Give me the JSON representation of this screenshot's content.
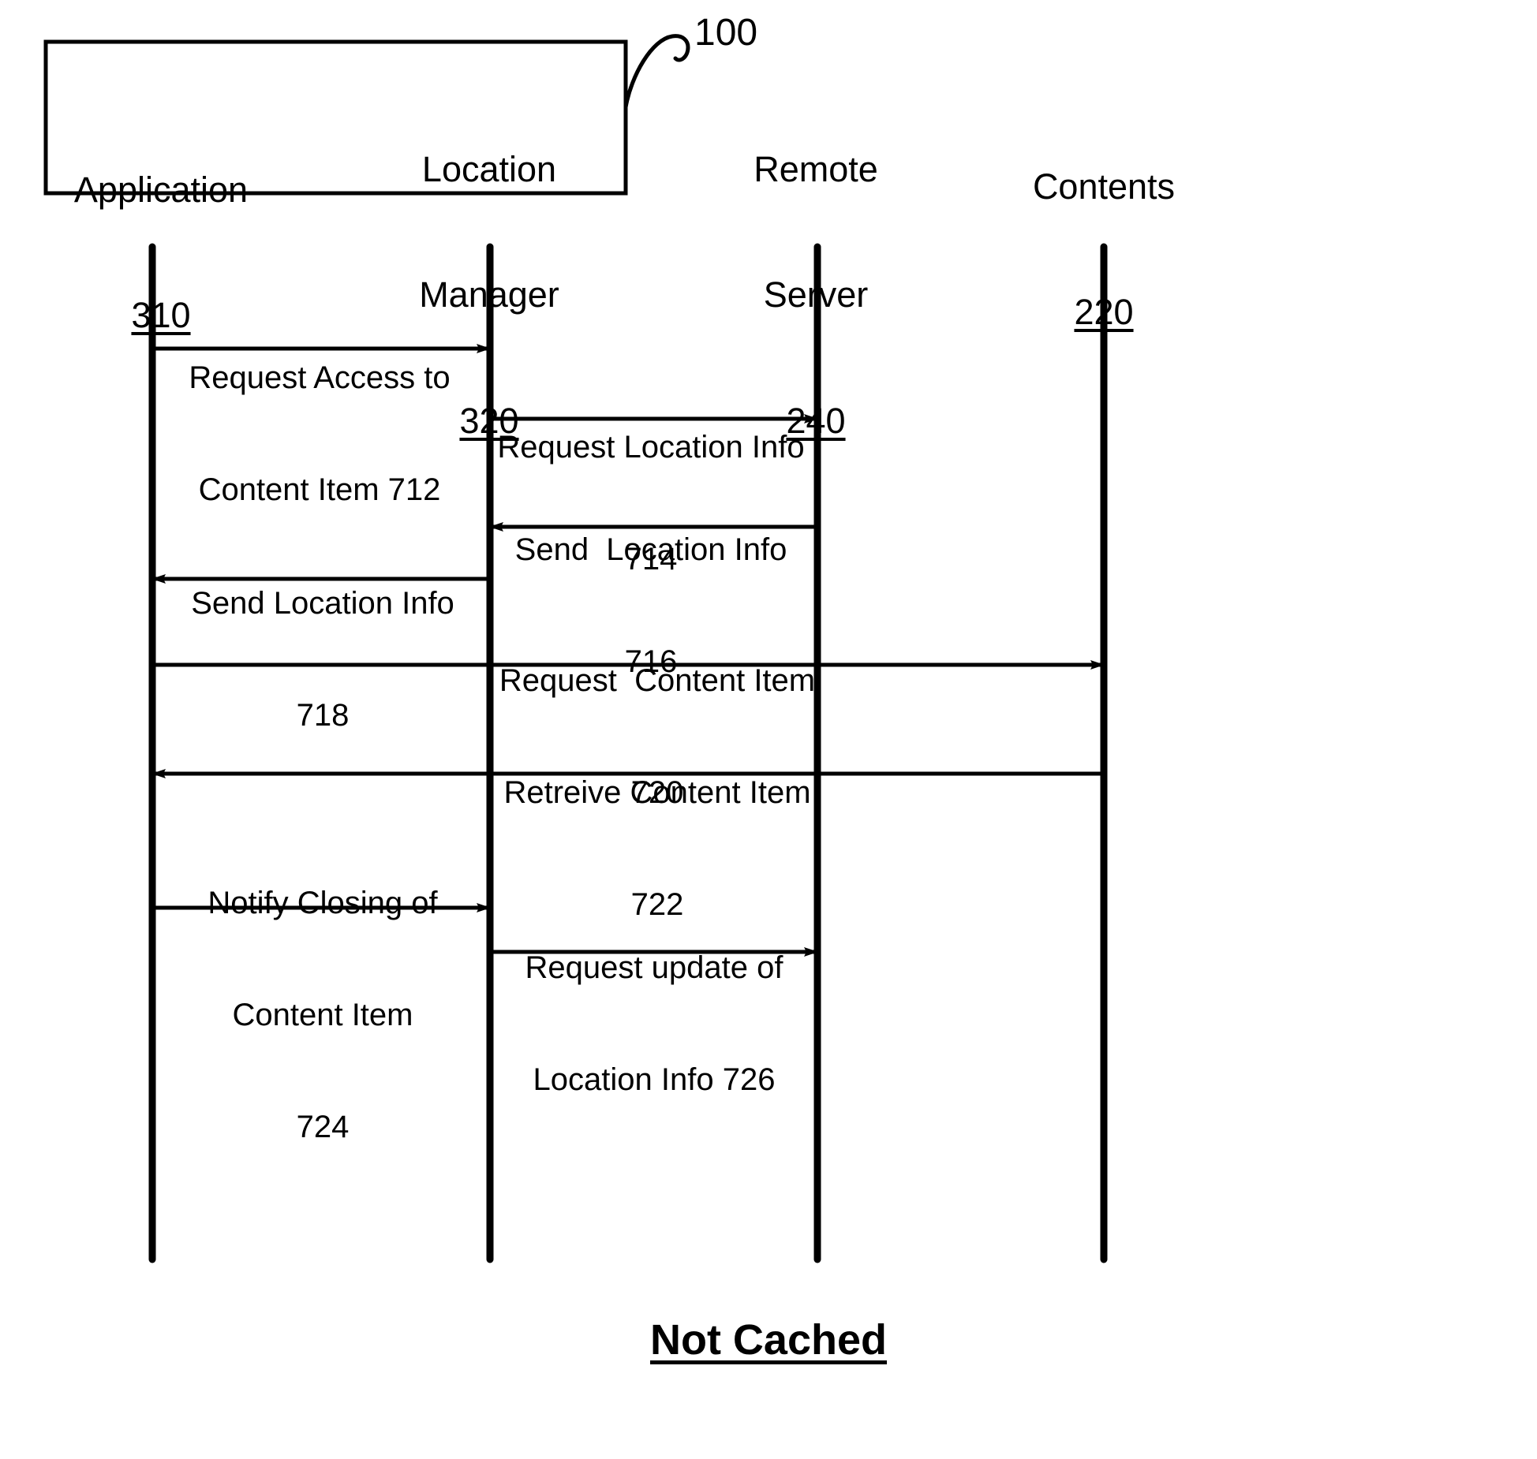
{
  "figure": {
    "callout_number": "100",
    "caption": "Not Cached"
  },
  "participants": [
    {
      "name": "Application",
      "number": "310",
      "in_box": true
    },
    {
      "name": "Location\nManager",
      "number": "320",
      "in_box": true
    },
    {
      "name": "Remote\nServer",
      "number": "240",
      "in_box": false
    },
    {
      "name": "Contents",
      "number": "220",
      "in_box": false
    }
  ],
  "participant_labels": {
    "application_name": "Application",
    "application_number": "310",
    "location_manager_name_line1": "Location",
    "location_manager_name_line2": "Manager",
    "location_manager_number": "320",
    "remote_server_name_line1": "Remote",
    "remote_server_name_line2": "Server",
    "remote_server_number": "240",
    "contents_name": "Contents",
    "contents_number": "220"
  },
  "messages": [
    {
      "id": "712",
      "lines": [
        "Request Access to",
        "Content Item 712"
      ],
      "from": "Application",
      "to": "Location Manager",
      "direction": "right"
    },
    {
      "id": "714",
      "lines": [
        "Request Location Info",
        "714"
      ],
      "from": "Location Manager",
      "to": "Remote Server",
      "direction": "right"
    },
    {
      "id": "716",
      "lines": [
        "Send  Location Info",
        "716"
      ],
      "from": "Remote Server",
      "to": "Location Manager",
      "direction": "left"
    },
    {
      "id": "718",
      "lines": [
        "Send Location Info",
        "718"
      ],
      "from": "Location Manager",
      "to": "Application",
      "direction": "left"
    },
    {
      "id": "720",
      "lines": [
        "Request  Content Item",
        "720"
      ],
      "from": "Application",
      "to": "Contents",
      "direction": "right"
    },
    {
      "id": "722",
      "lines": [
        "Retreive Content Item",
        "722"
      ],
      "from": "Contents",
      "to": "Application",
      "direction": "left"
    },
    {
      "id": "724",
      "lines": [
        "Notify Closing of",
        "Content Item",
        "724"
      ],
      "from": "Application",
      "to": "Location Manager",
      "direction": "right"
    },
    {
      "id": "726",
      "lines": [
        "Request update of",
        "Location Info 726"
      ],
      "from": "Location Manager",
      "to": "Remote Server",
      "direction": "right"
    }
  ],
  "colors": {
    "ink": "#000000",
    "paper": "#ffffff"
  }
}
